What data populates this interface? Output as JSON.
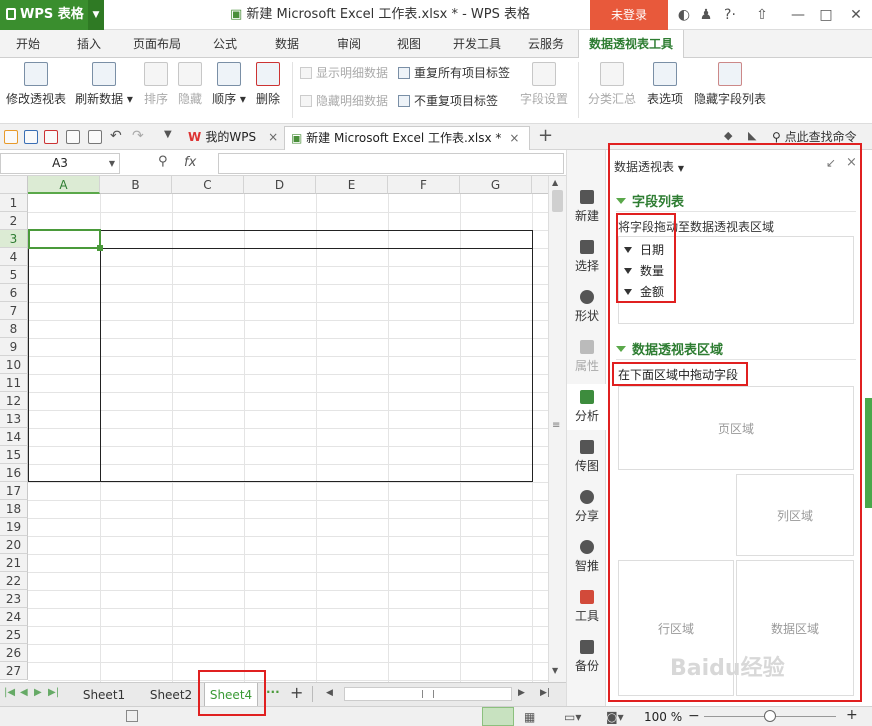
{
  "app": {
    "name": "WPS 表格",
    "title": "新建 Microsoft Excel 工作表.xlsx * - WPS 表格",
    "login": "未登录"
  },
  "menu_tabs": [
    "开始",
    "插入",
    "页面布局",
    "公式",
    "数据",
    "审阅",
    "视图",
    "开发工具",
    "云服务",
    "数据透视表工具"
  ],
  "ribbon": {
    "modify": "修改透视表",
    "refresh": "刷新数据",
    "sort": "排序",
    "hide": "隐藏",
    "order": "顺序",
    "delete": "删除",
    "show_detail": "显示明细数据",
    "hide_detail": "隐藏明细数据",
    "repeat_labels": "重复所有项目标签",
    "norepeat_labels": "不重复项目标签",
    "field_settings": "字段设置",
    "subtotal": "分类汇总",
    "table_options": "表选项",
    "hide_field_list": "隐藏字段列表"
  },
  "docbar": {
    "mywps": "我的WPS",
    "doc": "新建 Microsoft Excel 工作表.xlsx *",
    "search": "点此查找命令"
  },
  "formula": {
    "cell": "A3",
    "fx": "fx",
    "value": ""
  },
  "columns": [
    "A",
    "B",
    "C",
    "D",
    "E",
    "F",
    "G"
  ],
  "rows": [
    "1",
    "2",
    "3",
    "4",
    "5",
    "6",
    "7",
    "8",
    "9",
    "10",
    "11",
    "12",
    "13",
    "14",
    "15",
    "16",
    "17",
    "18",
    "19",
    "20",
    "21",
    "22",
    "23",
    "24",
    "25",
    "26",
    "27"
  ],
  "sheets": [
    "Sheet1",
    "Sheet2",
    "Sheet4"
  ],
  "sidebar": [
    "新建",
    "选择",
    "形状",
    "属性",
    "分析",
    "传图",
    "分享",
    "智推",
    "工具",
    "备份"
  ],
  "pivot": {
    "title": "数据透视表",
    "field_list": "字段列表",
    "drag_hint": "将字段拖动至数据透视表区域",
    "fields": [
      "日期",
      "数量",
      "金额"
    ],
    "area_title": "数据透视表区域",
    "area_hint": "在下面区域中拖动字段",
    "page_area": "页区域",
    "col_area": "列区域",
    "row_area": "行区域",
    "data_area": "数据区域"
  },
  "status": {
    "zoom": "100 %"
  },
  "watermark": "Baidu经验",
  "colors": {
    "accent": "#3a8e2e",
    "login": "#e8593b",
    "highlight": "#e02020"
  }
}
